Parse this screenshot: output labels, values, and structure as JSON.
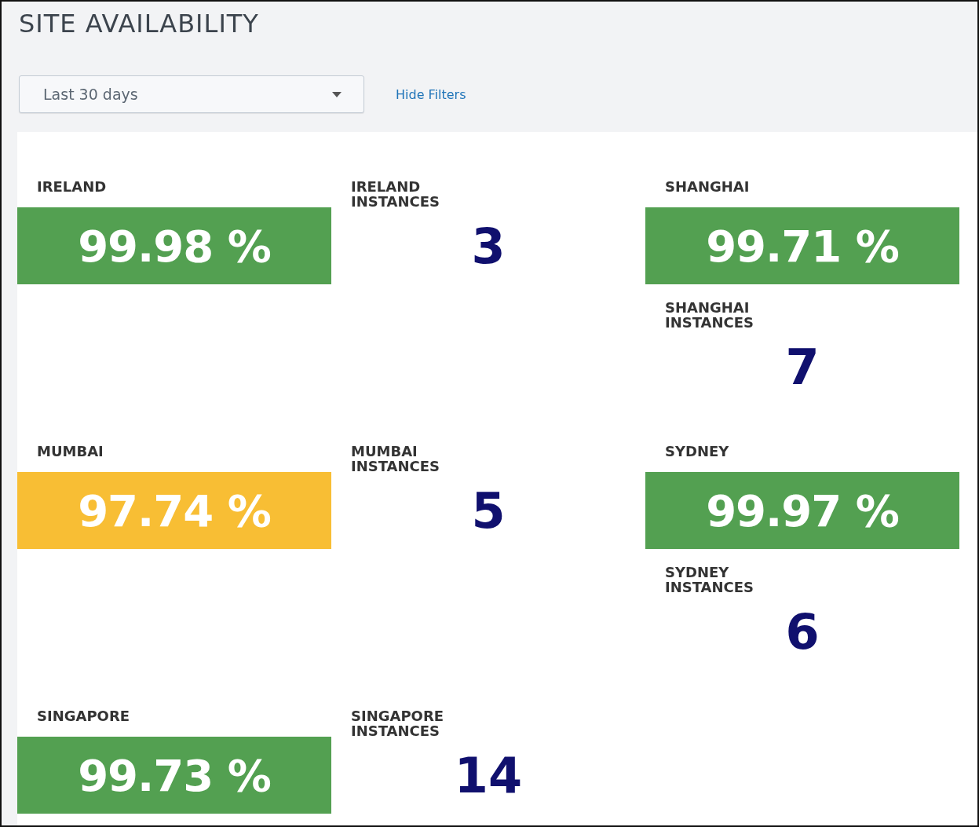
{
  "title": "SITE AVAILABILITY",
  "filters": {
    "time_range": {
      "value": "Last 30 days"
    },
    "toggle_link": "Hide Filters"
  },
  "rows": [
    {
      "panels": [
        {
          "tiles": [
            {
              "kind": "uptime",
              "label": "IRELAND",
              "value": "99.98 %",
              "color": "#53a051"
            }
          ]
        },
        {
          "tiles": [
            {
              "kind": "count",
              "label": "IRELAND INSTANCES",
              "value": "3"
            }
          ]
        },
        {
          "tiles": [
            {
              "kind": "uptime",
              "label": "SHANGHAI",
              "value": "99.71 %",
              "color": "#53a051"
            },
            {
              "kind": "count",
              "label": "SHANGHAI INSTANCES",
              "value": "7"
            }
          ]
        }
      ]
    },
    {
      "panels": [
        {
          "tiles": [
            {
              "kind": "uptime",
              "label": "MUMBAI",
              "value": "97.74 %",
              "color": "#f8be34"
            }
          ]
        },
        {
          "tiles": [
            {
              "kind": "count",
              "label": "MUMBAI INSTANCES",
              "value": "5"
            }
          ]
        },
        {
          "tiles": [
            {
              "kind": "uptime",
              "label": "SYDNEY",
              "value": "99.97 %",
              "color": "#53a051"
            },
            {
              "kind": "count",
              "label": "SYDNEY INSTANCES",
              "value": "6"
            }
          ]
        }
      ]
    },
    {
      "panels": [
        {
          "tiles": [
            {
              "kind": "uptime",
              "label": "SINGAPORE",
              "value": "99.73 %",
              "color": "#53a051"
            }
          ]
        },
        {
          "tiles": [
            {
              "kind": "count",
              "label": "SINGAPORE INSTANCES",
              "value": "14"
            }
          ]
        }
      ]
    }
  ]
}
